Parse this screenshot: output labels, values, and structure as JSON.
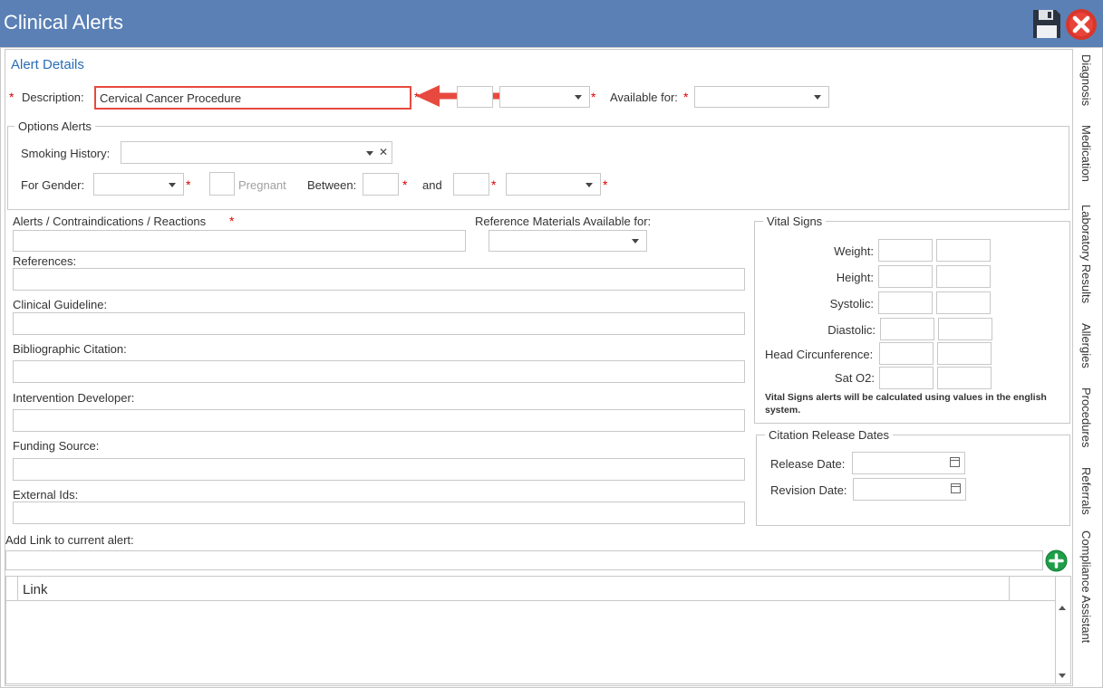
{
  "window": {
    "title": "Clinical Alerts",
    "save_icon": "floppy-disk-icon",
    "close_icon": "close-circle-icon"
  },
  "alert_details": {
    "heading": "Alert Details",
    "description_label": "Description:",
    "description_value": "Cervical Cancer Procedure",
    "available_for_label": "Available for:"
  },
  "options_alerts": {
    "legend": "Options Alerts",
    "smoking_history_label": "Smoking History:",
    "clear_symbol": "✕",
    "for_gender_label": "For Gender:",
    "pregnant_label": "Pregnant",
    "between_label": "Between:",
    "and_label": "and"
  },
  "fields": {
    "alerts_label": "Alerts / Contraindications / Reactions",
    "reference_materials_label": "Reference Materials Available for:",
    "references_label": "References:",
    "clinical_guideline_label": "Clinical Guideline:",
    "bibliographic_citation_label": "Bibliographic Citation:",
    "intervention_developer_label": "Intervention Developer:",
    "funding_source_label": "Funding Source:",
    "external_ids_label": "External Ids:"
  },
  "vital_signs": {
    "legend": "Vital Signs",
    "rows": [
      "Weight:",
      "Height:",
      "Systolic:",
      "Diastolic:",
      "Head Circunference:",
      "Sat O2:"
    ],
    "note": "Vital Signs alerts will be calculated using values in the english system."
  },
  "citation_release": {
    "legend": "Citation Release Dates",
    "release_date_label": "Release Date:",
    "revision_date_label": "Revision Date:"
  },
  "links": {
    "add_link_label": "Add Link to current alert:",
    "add_icon": "plus-circle-icon",
    "column_link": "Link"
  },
  "side_tabs": [
    "Diagnosis",
    "Medication",
    "Laboratory Results",
    "Allergies",
    "Procedures",
    "Referrals",
    "Compliance Assistant"
  ],
  "colors": {
    "titlebar": "#5a80b5",
    "accent": "#2a6db5",
    "required": "#dd0000",
    "highlight": "#e8493f",
    "add": "#1e9e47"
  }
}
